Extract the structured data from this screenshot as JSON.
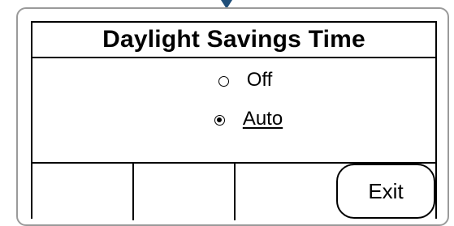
{
  "screen": {
    "title": "Daylight Savings Time"
  },
  "options": [
    {
      "label": "Off",
      "selected": false
    },
    {
      "label": "Auto",
      "selected": true
    }
  ],
  "softkeys": {
    "key1": "",
    "key2": "",
    "key3": "",
    "key4": "Exit"
  }
}
